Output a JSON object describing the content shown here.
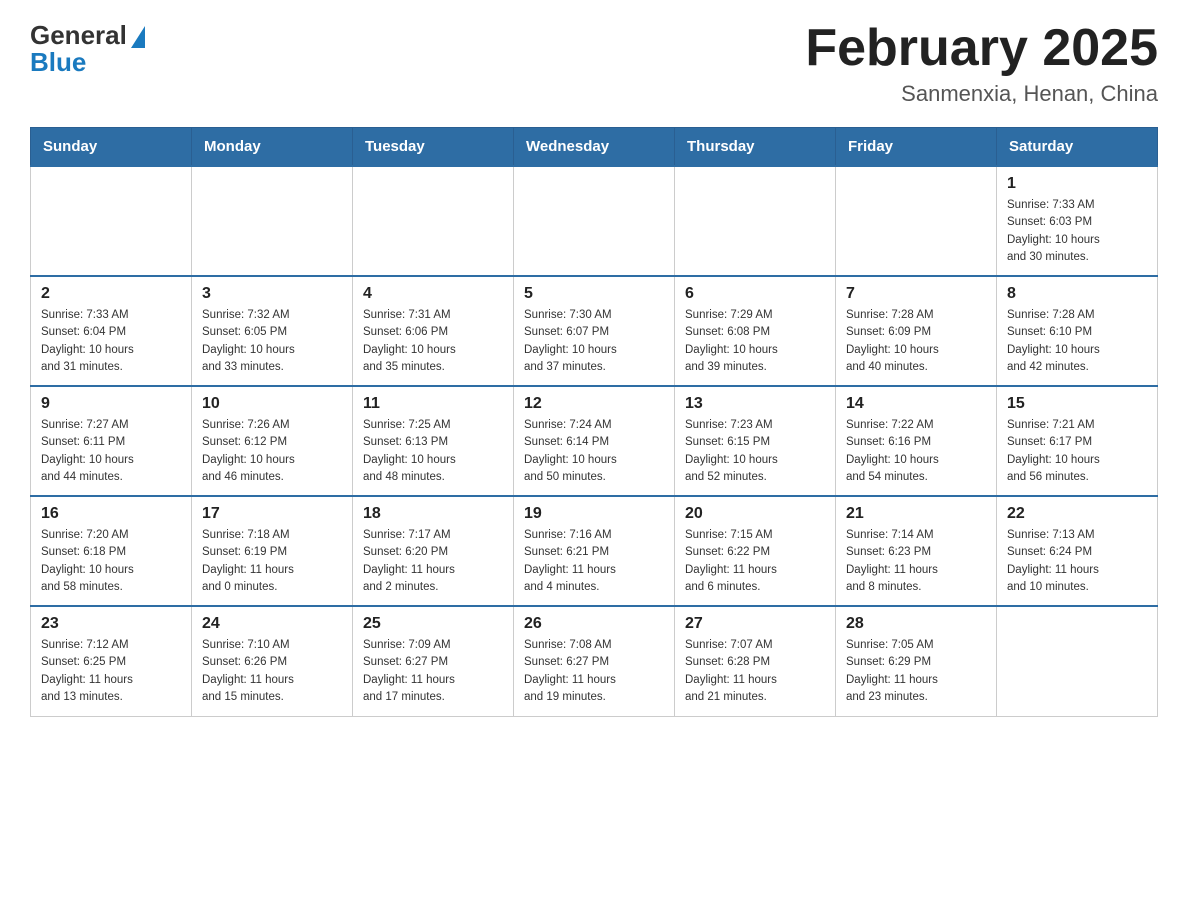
{
  "header": {
    "logo": {
      "general": "General",
      "blue": "Blue"
    },
    "title": "February 2025",
    "location": "Sanmenxia, Henan, China"
  },
  "days_of_week": [
    "Sunday",
    "Monday",
    "Tuesday",
    "Wednesday",
    "Thursday",
    "Friday",
    "Saturday"
  ],
  "weeks": [
    [
      {
        "day": "",
        "info": ""
      },
      {
        "day": "",
        "info": ""
      },
      {
        "day": "",
        "info": ""
      },
      {
        "day": "",
        "info": ""
      },
      {
        "day": "",
        "info": ""
      },
      {
        "day": "",
        "info": ""
      },
      {
        "day": "1",
        "info": "Sunrise: 7:33 AM\nSunset: 6:03 PM\nDaylight: 10 hours\nand 30 minutes."
      }
    ],
    [
      {
        "day": "2",
        "info": "Sunrise: 7:33 AM\nSunset: 6:04 PM\nDaylight: 10 hours\nand 31 minutes."
      },
      {
        "day": "3",
        "info": "Sunrise: 7:32 AM\nSunset: 6:05 PM\nDaylight: 10 hours\nand 33 minutes."
      },
      {
        "day": "4",
        "info": "Sunrise: 7:31 AM\nSunset: 6:06 PM\nDaylight: 10 hours\nand 35 minutes."
      },
      {
        "day": "5",
        "info": "Sunrise: 7:30 AM\nSunset: 6:07 PM\nDaylight: 10 hours\nand 37 minutes."
      },
      {
        "day": "6",
        "info": "Sunrise: 7:29 AM\nSunset: 6:08 PM\nDaylight: 10 hours\nand 39 minutes."
      },
      {
        "day": "7",
        "info": "Sunrise: 7:28 AM\nSunset: 6:09 PM\nDaylight: 10 hours\nand 40 minutes."
      },
      {
        "day": "8",
        "info": "Sunrise: 7:28 AM\nSunset: 6:10 PM\nDaylight: 10 hours\nand 42 minutes."
      }
    ],
    [
      {
        "day": "9",
        "info": "Sunrise: 7:27 AM\nSunset: 6:11 PM\nDaylight: 10 hours\nand 44 minutes."
      },
      {
        "day": "10",
        "info": "Sunrise: 7:26 AM\nSunset: 6:12 PM\nDaylight: 10 hours\nand 46 minutes."
      },
      {
        "day": "11",
        "info": "Sunrise: 7:25 AM\nSunset: 6:13 PM\nDaylight: 10 hours\nand 48 minutes."
      },
      {
        "day": "12",
        "info": "Sunrise: 7:24 AM\nSunset: 6:14 PM\nDaylight: 10 hours\nand 50 minutes."
      },
      {
        "day": "13",
        "info": "Sunrise: 7:23 AM\nSunset: 6:15 PM\nDaylight: 10 hours\nand 52 minutes."
      },
      {
        "day": "14",
        "info": "Sunrise: 7:22 AM\nSunset: 6:16 PM\nDaylight: 10 hours\nand 54 minutes."
      },
      {
        "day": "15",
        "info": "Sunrise: 7:21 AM\nSunset: 6:17 PM\nDaylight: 10 hours\nand 56 minutes."
      }
    ],
    [
      {
        "day": "16",
        "info": "Sunrise: 7:20 AM\nSunset: 6:18 PM\nDaylight: 10 hours\nand 58 minutes."
      },
      {
        "day": "17",
        "info": "Sunrise: 7:18 AM\nSunset: 6:19 PM\nDaylight: 11 hours\nand 0 minutes."
      },
      {
        "day": "18",
        "info": "Sunrise: 7:17 AM\nSunset: 6:20 PM\nDaylight: 11 hours\nand 2 minutes."
      },
      {
        "day": "19",
        "info": "Sunrise: 7:16 AM\nSunset: 6:21 PM\nDaylight: 11 hours\nand 4 minutes."
      },
      {
        "day": "20",
        "info": "Sunrise: 7:15 AM\nSunset: 6:22 PM\nDaylight: 11 hours\nand 6 minutes."
      },
      {
        "day": "21",
        "info": "Sunrise: 7:14 AM\nSunset: 6:23 PM\nDaylight: 11 hours\nand 8 minutes."
      },
      {
        "day": "22",
        "info": "Sunrise: 7:13 AM\nSunset: 6:24 PM\nDaylight: 11 hours\nand 10 minutes."
      }
    ],
    [
      {
        "day": "23",
        "info": "Sunrise: 7:12 AM\nSunset: 6:25 PM\nDaylight: 11 hours\nand 13 minutes."
      },
      {
        "day": "24",
        "info": "Sunrise: 7:10 AM\nSunset: 6:26 PM\nDaylight: 11 hours\nand 15 minutes."
      },
      {
        "day": "25",
        "info": "Sunrise: 7:09 AM\nSunset: 6:27 PM\nDaylight: 11 hours\nand 17 minutes."
      },
      {
        "day": "26",
        "info": "Sunrise: 7:08 AM\nSunset: 6:27 PM\nDaylight: 11 hours\nand 19 minutes."
      },
      {
        "day": "27",
        "info": "Sunrise: 7:07 AM\nSunset: 6:28 PM\nDaylight: 11 hours\nand 21 minutes."
      },
      {
        "day": "28",
        "info": "Sunrise: 7:05 AM\nSunset: 6:29 PM\nDaylight: 11 hours\nand 23 minutes."
      },
      {
        "day": "",
        "info": ""
      }
    ]
  ]
}
